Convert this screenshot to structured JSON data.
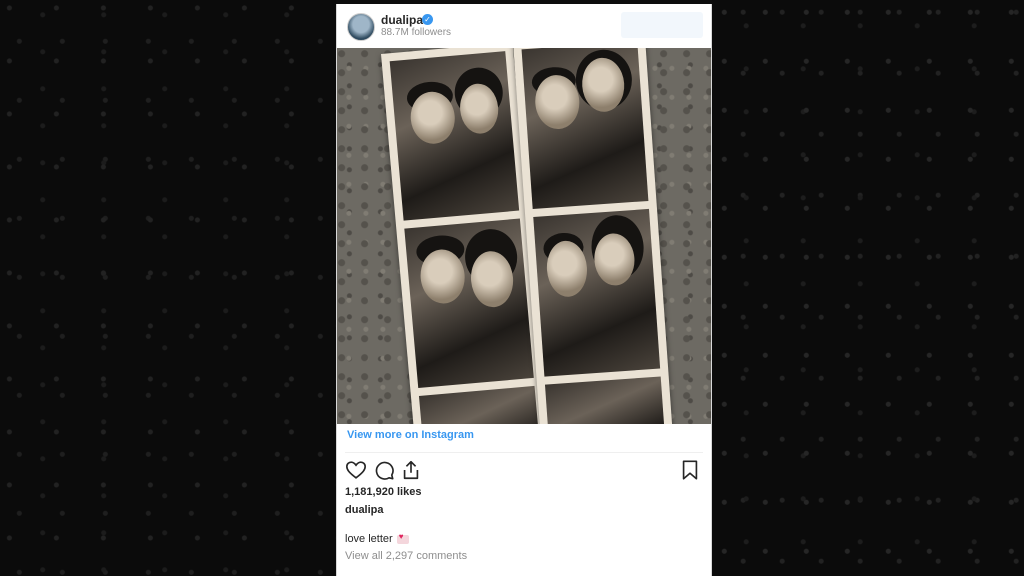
{
  "post": {
    "username": "dualipa",
    "followers": "88.7M followers",
    "view_more": "View more on Instagram",
    "likes": "1,181,920 likes",
    "author": "dualipa",
    "caption": "love letter",
    "comments": "View all 2,297 comments"
  },
  "icons": {
    "verified": "verified-badge-icon",
    "like": "heart-icon",
    "comment": "comment-icon",
    "share": "share-icon",
    "save": "bookmark-icon"
  },
  "colors": {
    "link": "#3897f0",
    "text": "#262626",
    "muted": "#8e8e8e"
  }
}
